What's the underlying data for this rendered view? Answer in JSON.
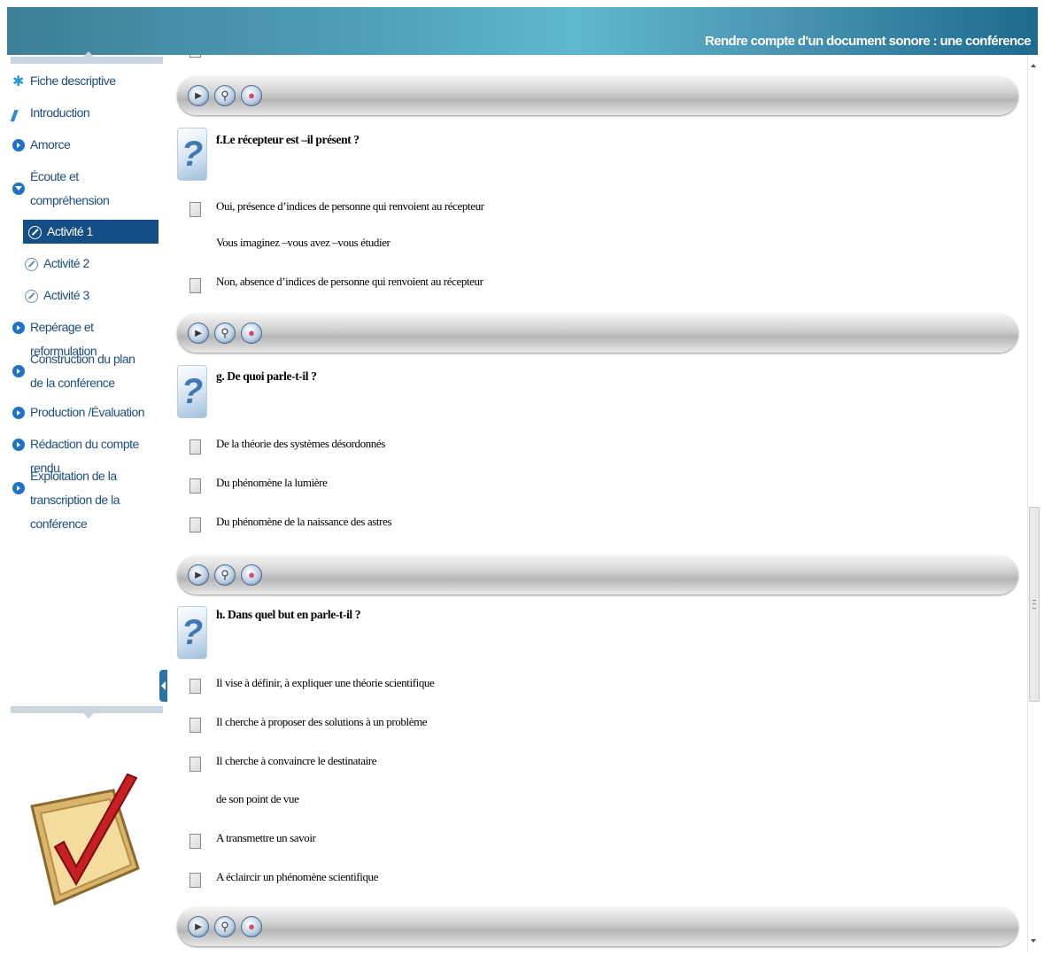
{
  "header": {
    "title": "Rendre compte d'un document sonore : une conférence"
  },
  "sidebar": {
    "items": [
      {
        "label": "Fiche descriptive"
      },
      {
        "label": "Introduction"
      },
      {
        "label": "Amorce"
      },
      {
        "label": "Écoute et compréhension globale"
      },
      {
        "label": "Activité 1"
      },
      {
        "label": "Activité 2"
      },
      {
        "label": "Activité 3"
      },
      {
        "label": "Repérage et reformulation"
      },
      {
        "label": "Construction du plan de la conférence"
      },
      {
        "label": "Production /Évaluation"
      },
      {
        "label": "Rédaction du compte rendu"
      },
      {
        "label": "Exploitation de la transcription de la conférence"
      }
    ]
  },
  "questions": [
    {
      "text": "f.Le récepteur est –il présent ?",
      "options": [
        "Oui, présence d’indices de personne qui renvoient au récepteur",
        "Vous imaginez –vous avez –vous étudier",
        "Non, absence d’indices de personne qui renvoient au récepteur"
      ]
    },
    {
      "text": "g. De quoi parle-t-il ?",
      "options": [
        "De la théorie des systèmes désordonnés",
        "Du phénomène la lumière",
        "Du phénomène de la naissance des astres"
      ]
    },
    {
      "text": "h. Dans quel but en parle-t-il ?",
      "options": [
        "Il vise à définir, à expliquer une théorie scientifique",
        "Il cherche à proposer des solutions à un problème",
        "Il cherche à convaincre le destinataire",
        "de son point de vue",
        "A transmettre un savoir",
        "A éclaircir un phénomène scientifique"
      ]
    }
  ],
  "colors": {
    "header": "#3c7f99",
    "active_menu": "#134e84",
    "menu_text": "#1b4d7e"
  },
  "icons": [
    "star-icon",
    "bolt-icon",
    "arrow-circle-icon",
    "chevron-down-circle-icon",
    "activity-icon",
    "play-button-icon",
    "help-button-icon",
    "eraser-button-icon",
    "question-icon",
    "checkmark-logo-icon"
  ]
}
